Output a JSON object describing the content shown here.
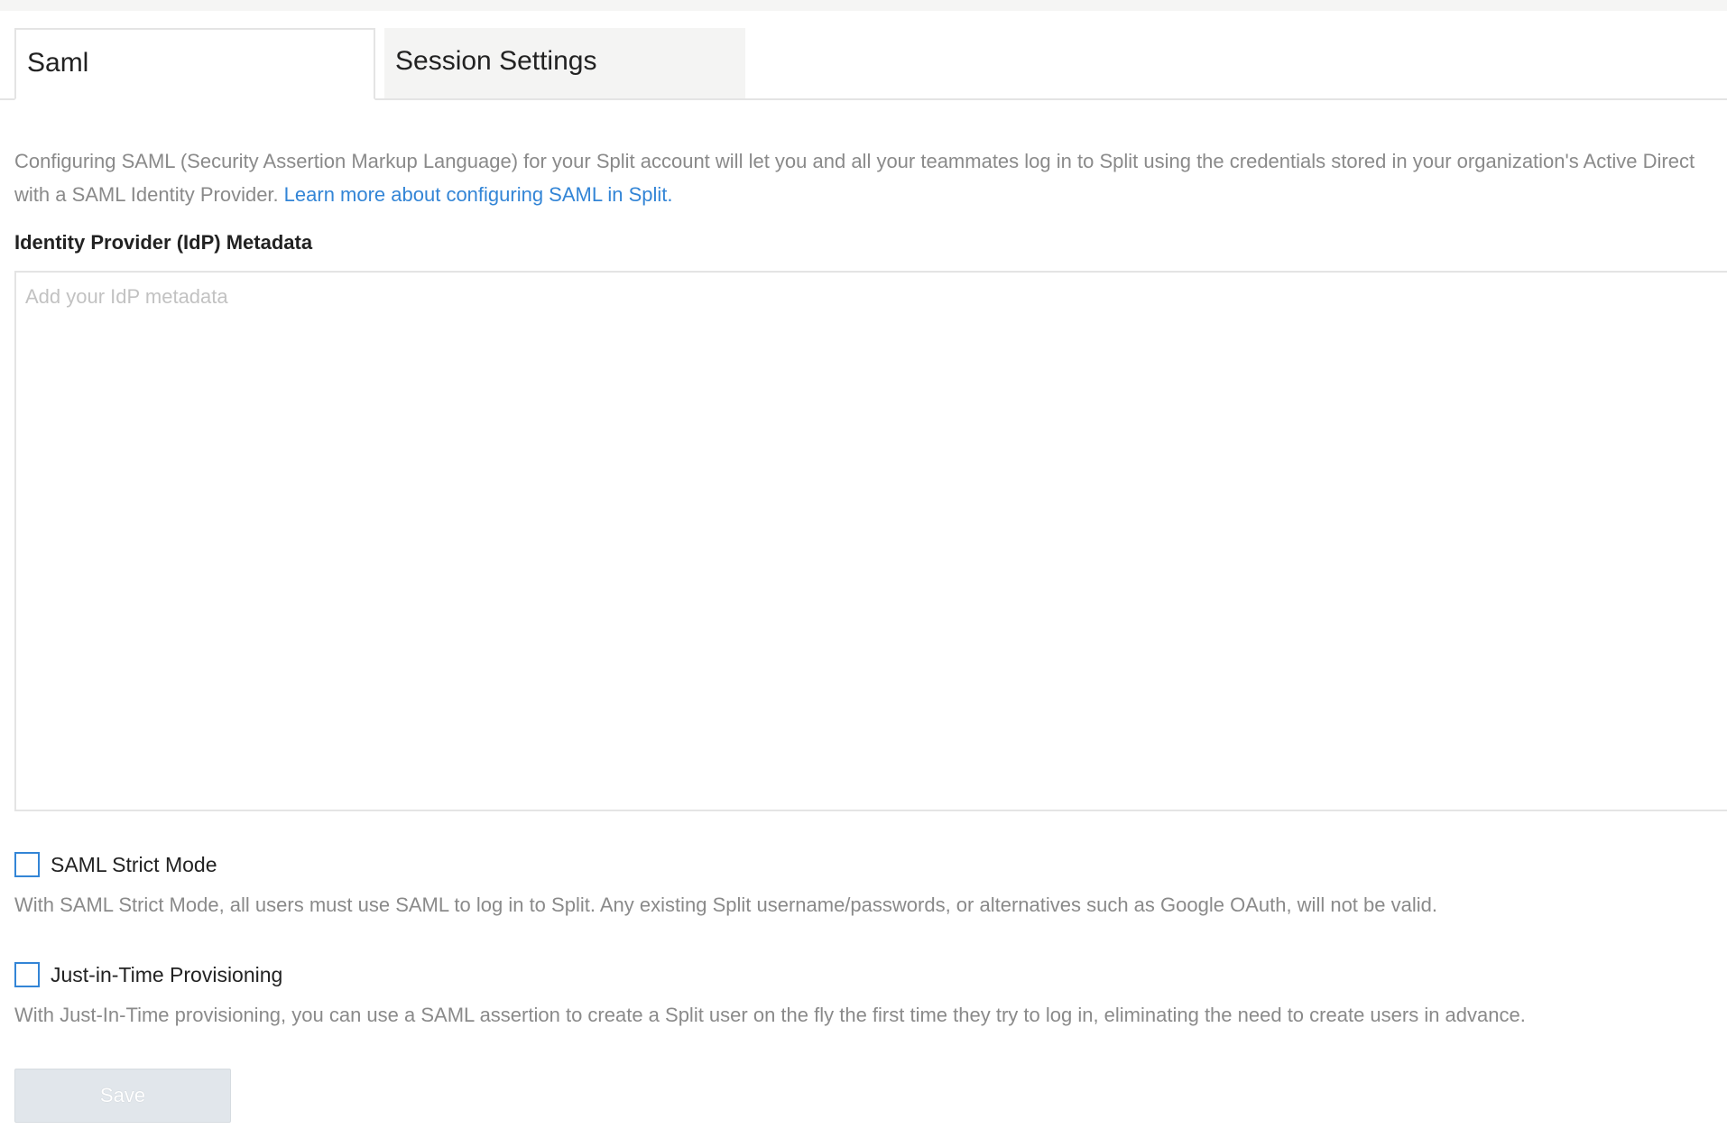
{
  "tabs": [
    {
      "label": "Saml",
      "active": true
    },
    {
      "label": "Session Settings",
      "active": false
    }
  ],
  "description": {
    "line1": "Configuring SAML (Security Assertion Markup Language) for your Split account will let you and all your teammates log in to Split using the credentials stored in your organization's Active Direct",
    "line2": "with a SAML Identity Provider.",
    "link": "Learn more about configuring SAML in Split."
  },
  "metadata_field": {
    "label": "Identity Provider (IdP) Metadata",
    "placeholder": "Add your IdP metadata",
    "value": ""
  },
  "strict_mode": {
    "label": "SAML Strict Mode",
    "checked": false,
    "help": "With SAML Strict Mode, all users must use SAML to log in to Split. Any existing Split username/passwords, or alternatives such as Google OAuth, will not be valid."
  },
  "jit_provisioning": {
    "label": "Just-in-Time Provisioning",
    "checked": false,
    "help": "With Just-In-Time provisioning, you can use a SAML assertion to create a Split user on the fly the first time they try to log in, eliminating the need to create users in advance."
  },
  "save_button": {
    "label": "Save",
    "disabled": true
  },
  "colors": {
    "accent": "#3385d6",
    "muted_text": "#8a8a8a",
    "border": "#e4e4e4",
    "disabled_button": "#e1e6eb"
  }
}
